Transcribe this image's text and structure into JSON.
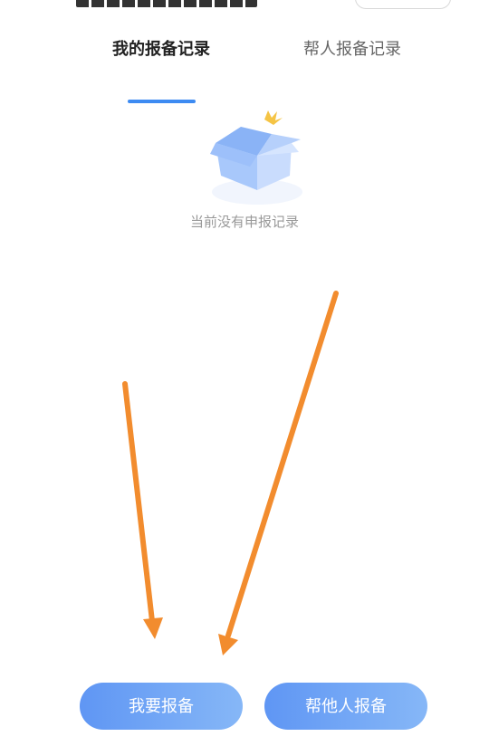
{
  "tabs": [
    {
      "label": "我的报备记录",
      "active": true
    },
    {
      "label": "帮人报备记录",
      "active": false
    }
  ],
  "empty_state": {
    "message": "当前没有申报记录",
    "icon": "empty-box-icon"
  },
  "actions": {
    "report_self": "我要报备",
    "report_others": "帮他人报备"
  },
  "colors": {
    "accent": "#3d8bf2",
    "button_gradient_start": "#5f96f4",
    "button_gradient_end": "#86b7f7",
    "arrow": "#f28c2e"
  }
}
